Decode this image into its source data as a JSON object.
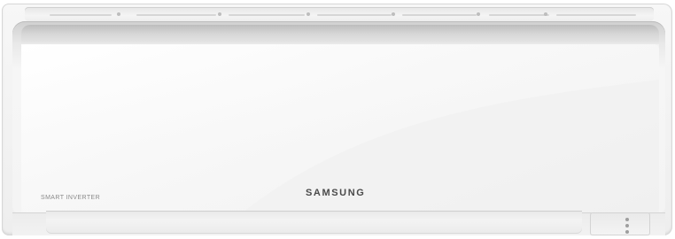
{
  "image": {
    "subject": "Wall-mounted split air conditioner indoor unit",
    "brand_text": "SAMSUNG",
    "series_text": "SMART INVERTER",
    "colors": {
      "body": "#f4f4f4",
      "trim": "#cfcfcf",
      "logo": "#4a4a4a",
      "series": "#8a8a8a"
    }
  }
}
